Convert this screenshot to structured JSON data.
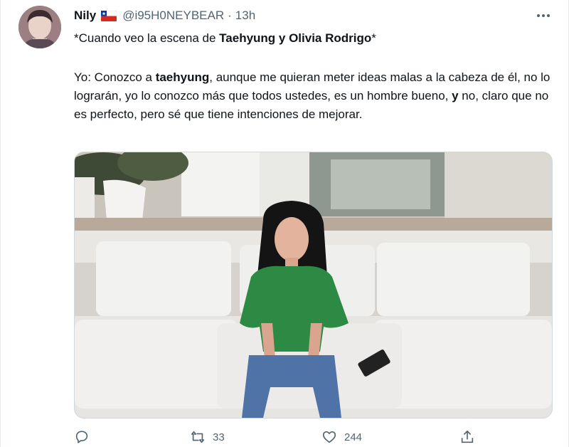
{
  "tweet": {
    "author_name": "Nily",
    "author_flag": "chile-flag-icon",
    "handle": "@i95H0NEYBEAR",
    "separator": "·",
    "time": "13h",
    "line1_prefix": "*Cuando veo la escena de ",
    "line1_bold": "Taehyung y Olivia Rodrigo",
    "line1_suffix": "*",
    "body": {
      "p1": "Yo: Conozco a ",
      "b1": "taehyung",
      "p2": ", aunque me quieran meter ideas malas a la cabeza de él, no lo lograrán, yo lo conozco más que todos ustedes, es un hombre bueno, ",
      "b2": "y",
      "p3": " no, claro que no es perfecto, pero sé que tiene intenciones de mejorar."
    },
    "media_description_icon": "photo-woman-on-white-sofa"
  },
  "actions": {
    "reply_icon": "reply-icon",
    "retweet_icon": "retweet-icon",
    "retweet_count": "33",
    "like_icon": "heart-icon",
    "like_count": "244",
    "share_icon": "share-icon"
  },
  "colors": {
    "text": "#0f1419",
    "secondary": "#536471",
    "border": "#cfd9de"
  }
}
